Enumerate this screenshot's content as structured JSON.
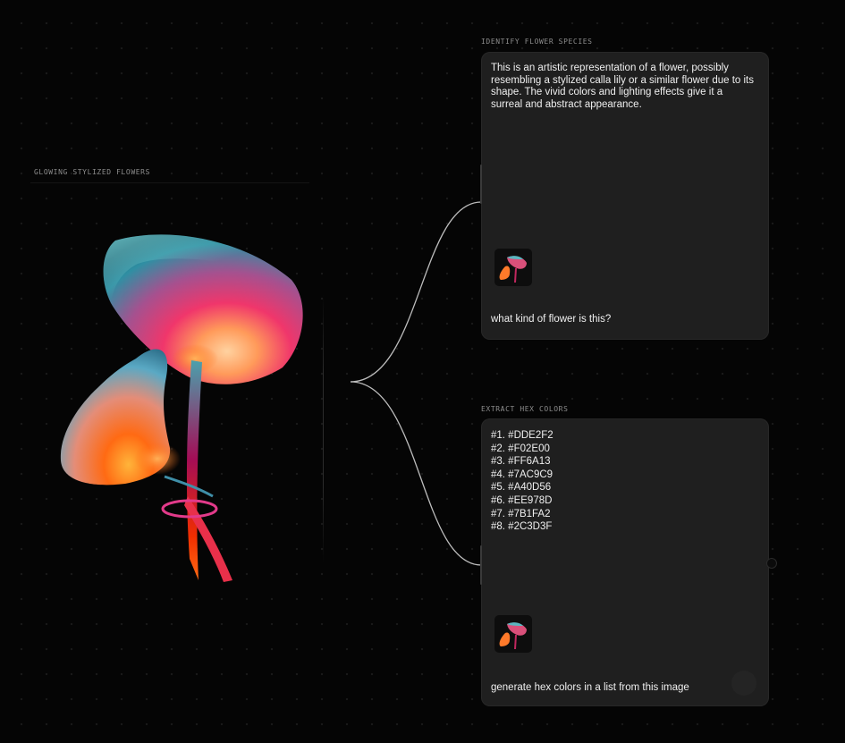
{
  "source": {
    "label": "GLOWING STYLIZED FLOWERS",
    "image_icon": "glowing-calla-lily-illustration"
  },
  "cards": [
    {
      "label": "IDENTIFY FLOWER SPECIES",
      "response": "This is an artistic representation of a flower, possibly resembling a stylized calla lily or a similar flower due to its shape. The vivid colors and lighting effects give it a surreal and abstract appearance.",
      "prompt": "what kind of flower is this?",
      "thumbnail_icon": "flower-thumbnail"
    },
    {
      "label": "EXTRACT HEX COLORS",
      "colors": [
        "#1. #DDE2F2",
        "#2. #F02E00",
        "#3. #FF6A13",
        "#4. #7AC9C9",
        "#5. #A40D56",
        "#6. #EE978D",
        "#7. #7B1FA2",
        "#8. #2C3D3F"
      ],
      "prompt": "generate hex colors in a list from this image",
      "thumbnail_icon": "flower-thumbnail"
    }
  ],
  "theme": {
    "background": "#050505",
    "card_background": "#1f1f1f",
    "connector": "#bdbdbd",
    "label_color": "#8d8d8d"
  }
}
